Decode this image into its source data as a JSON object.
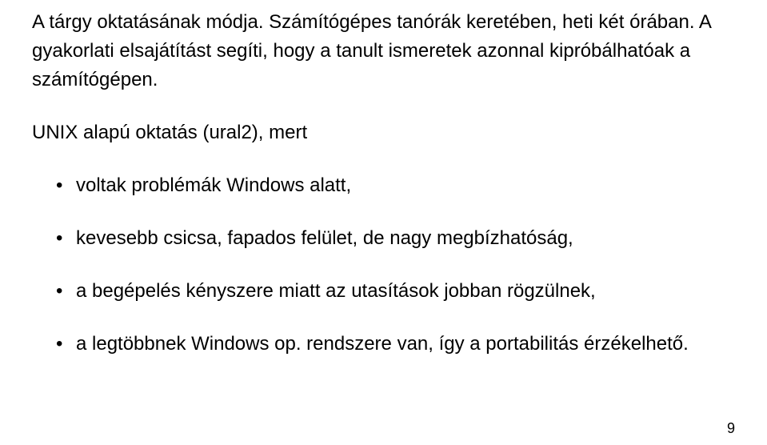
{
  "intro": "A tárgy oktatásának módja. Számítógépes tanórák keretében, heti két órában. A gyakorlati elsajátítást segíti, hogy a tanult ismeretek azonnal kipróbálhatóak a számítógépen.",
  "subheading": "UNIX alapú oktatás (ural2), mert",
  "bullets": [
    "voltak problémák Windows alatt,",
    "kevesebb csicsa, fapados felület, de nagy megbízhatóság,",
    "a begépelés kényszere miatt az utasítások jobban rögzülnek,",
    "a legtöbbnek Windows op. rendszere van, így a portabilitás érzékelhető."
  ],
  "page_number": "9"
}
